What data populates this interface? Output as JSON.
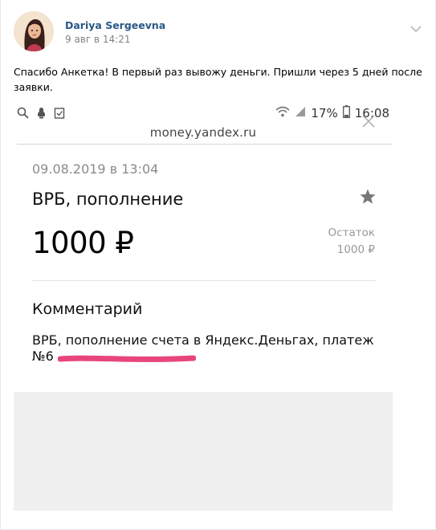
{
  "post": {
    "author": "Dariya Sergeevna",
    "date": "9 авг в 14:21",
    "text": "Спасибо Анкетка! В первый раз вывожу деньги. Пришли через 5 дней после заявки.",
    "menu_icon": "chevron-down-icon"
  },
  "status_bar": {
    "battery": "17%",
    "time": "16:08",
    "icons_left": [
      "search-icon",
      "notification-icon",
      "clipboard-check-icon"
    ],
    "icons_right": [
      "wifi-icon",
      "signal-icon",
      "battery-icon"
    ]
  },
  "browser": {
    "domain": "money.yandex.ru"
  },
  "transaction": {
    "datetime": "09.08.2019 в 13:04",
    "title": "ВРБ, пополнение",
    "amount": "1000 ₽",
    "balance_label": "Остаток",
    "balance_value": "1000 ₽",
    "comment_heading": "Комментарий",
    "comment_text": "ВРБ, пополнение счета в Яндекс.Деньгах, платеж №6",
    "redaction_color": "#e8457e"
  },
  "colors": {
    "author_link": "#2a5885",
    "meta_grey": "#828282",
    "placeholder_grey": "#f0f0f0"
  }
}
